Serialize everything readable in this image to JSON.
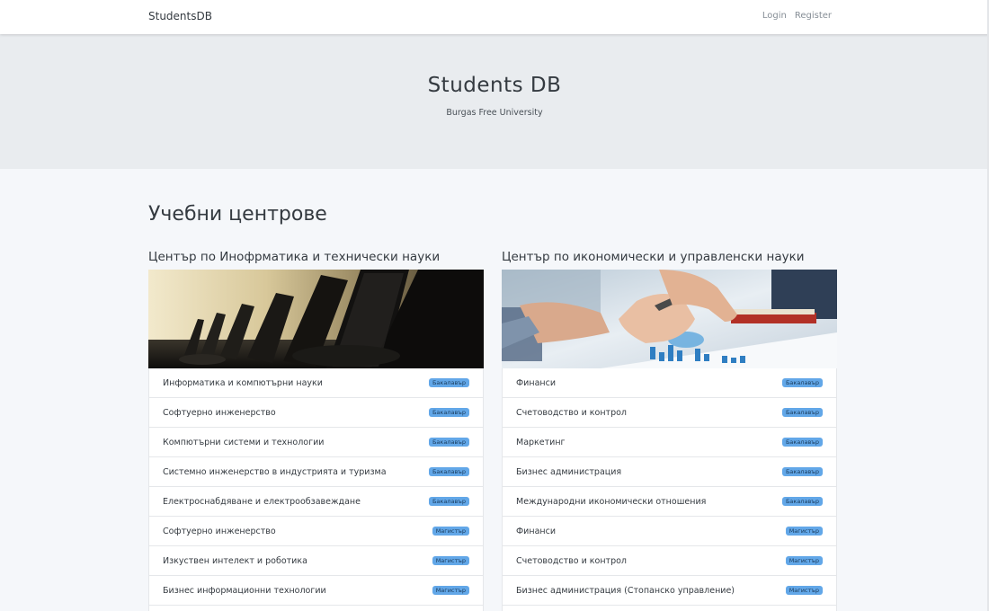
{
  "navbar": {
    "brand": "StudentsDB",
    "links": [
      "Login",
      "Register"
    ]
  },
  "jumbotron": {
    "title": "Students DB",
    "subtitle": "Burgas Free University"
  },
  "section_title": "Учебни центрове",
  "centers": [
    {
      "title": "Център по Инофрматика и технически науки",
      "image": "computer-lab-photo",
      "programs": [
        {
          "name": "Информатика и компютърни науки",
          "degree": "Бакалавър"
        },
        {
          "name": "Софтуерно инженерство",
          "degree": "Бакалавър"
        },
        {
          "name": "Компютърни системи и технологии",
          "degree": "Бакалавър"
        },
        {
          "name": "Системно инженерство в индустрията и туризма",
          "degree": "Бакалавър"
        },
        {
          "name": "Електроснабдяване и електрообзавеждане",
          "degree": "Бакалавър"
        },
        {
          "name": "Софтуерно инженерство",
          "degree": "Магистър"
        },
        {
          "name": "Изкуствен интелект и роботика",
          "degree": "Магистър"
        },
        {
          "name": "Бизнес информационни технологии",
          "degree": "Магистър"
        },
        {
          "name": "",
          "degree": ""
        }
      ]
    },
    {
      "title": "Център по икономически и управленски науки",
      "image": "business-charts-photo",
      "programs": [
        {
          "name": "Финанси",
          "degree": "Бакалавър"
        },
        {
          "name": "Счетоводство и контрол",
          "degree": "Бакалавър"
        },
        {
          "name": "Маркетинг",
          "degree": "Бакалавър"
        },
        {
          "name": "Бизнес администрация",
          "degree": "Бакалавър"
        },
        {
          "name": "Международни икономически отношения",
          "degree": "Бакалавър"
        },
        {
          "name": "Финанси",
          "degree": "Магистър"
        },
        {
          "name": "Счетоводство и контрол",
          "degree": "Магистър"
        },
        {
          "name": "Бизнес администрация (Стопанско управление)",
          "degree": "Магистър"
        },
        {
          "name": "",
          "degree": ""
        }
      ]
    }
  ],
  "colors": {
    "badge": "#62a7e8",
    "jumbotron_bg": "#e9ecef",
    "page_bg": "#f5f7fa"
  }
}
